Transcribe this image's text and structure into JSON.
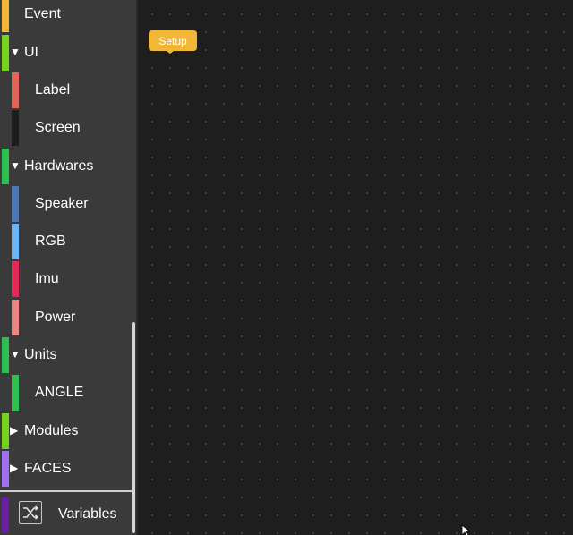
{
  "toolbox": {
    "categories": [
      {
        "label": "Event",
        "color": "#f3b737",
        "type": "top",
        "caret": ""
      },
      {
        "label": "UI",
        "color": "#74d51c",
        "type": "top",
        "caret": "▼"
      },
      {
        "label": "Label",
        "color": "#e0665a",
        "type": "sub",
        "caret": ""
      },
      {
        "label": "Screen",
        "color": "#1c1c1c",
        "type": "sub",
        "caret": ""
      },
      {
        "label": "Hardwares",
        "color": "#2ec051",
        "type": "top",
        "caret": "▼"
      },
      {
        "label": "Speaker",
        "color": "#4d78b6",
        "type": "sub",
        "caret": ""
      },
      {
        "label": "RGB",
        "color": "#6cb5f7",
        "type": "sub",
        "caret": ""
      },
      {
        "label": "Imu",
        "color": "#e22a56",
        "type": "sub",
        "caret": ""
      },
      {
        "label": "Power",
        "color": "#e98686",
        "type": "sub",
        "caret": ""
      },
      {
        "label": "Units",
        "color": "#2ec051",
        "type": "top",
        "caret": "▼"
      },
      {
        "label": "ANGLE",
        "color": "#2ec051",
        "type": "sub",
        "caret": ""
      },
      {
        "label": "Modules",
        "color": "#74d51c",
        "type": "top",
        "caret": "▶"
      },
      {
        "label": "FACES",
        "color": "#9f6ff0",
        "type": "top",
        "caret": "▶"
      }
    ],
    "variables": {
      "label": "Variables",
      "color": "#6a1fa0",
      "icon": "variables-shuffle-icon"
    }
  },
  "workspace": {
    "blocks": [
      {
        "label": "Setup",
        "color": "#f3b737"
      }
    ]
  }
}
